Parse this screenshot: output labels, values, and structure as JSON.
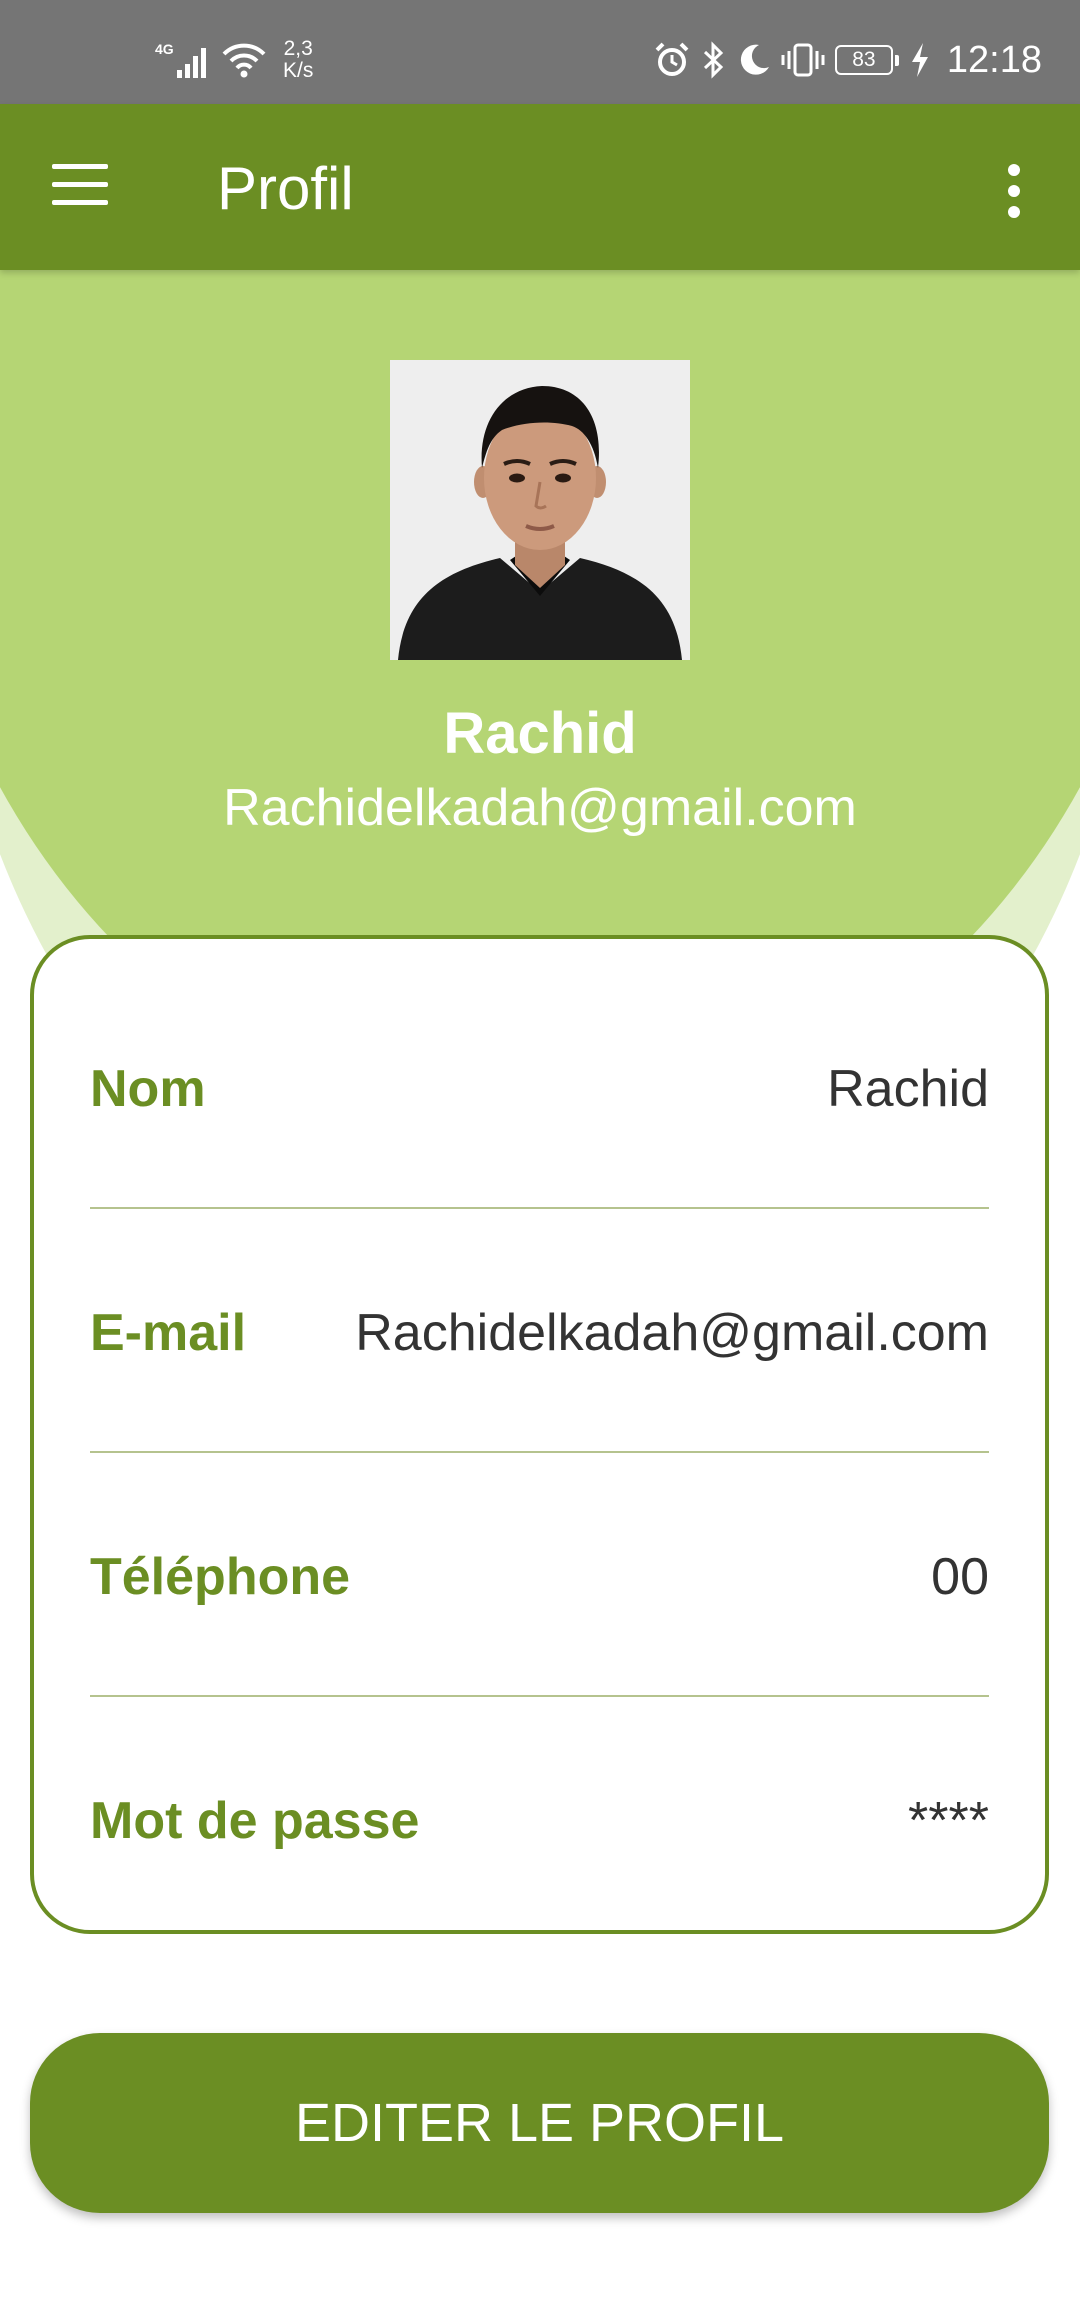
{
  "status_bar": {
    "network": "4G",
    "speed_value": "2,3",
    "speed_unit": "K/s",
    "battery": "83",
    "time": "12:18",
    "icons": [
      "signal-icon",
      "wifi-icon",
      "alarm-icon",
      "bluetooth-icon",
      "moon-icon",
      "vibrate-icon",
      "battery-icon",
      "charging-icon"
    ]
  },
  "app_bar": {
    "title": "Profil",
    "icons": [
      "menu-icon",
      "more-vertical-icon"
    ]
  },
  "profile": {
    "name": "Rachid",
    "email": "Rachidelkadah@gmail.com"
  },
  "info": {
    "rows": [
      {
        "label": "Nom",
        "value": "Rachid"
      },
      {
        "label": "E-mail",
        "value": "Rachidelkadah@gmail.com"
      },
      {
        "label": "Téléphone",
        "value": "00"
      },
      {
        "label": "Mot de passe",
        "value": "****"
      }
    ]
  },
  "actions": {
    "edit_label": "EDITER LE PROFIL"
  },
  "colors": {
    "primary": "#6b8e23",
    "header_background": "#b5d574",
    "header_background_light": "#e3f0cc",
    "status_bar": "#757575",
    "card_background": "#ffffff",
    "value_text": "#333333"
  }
}
